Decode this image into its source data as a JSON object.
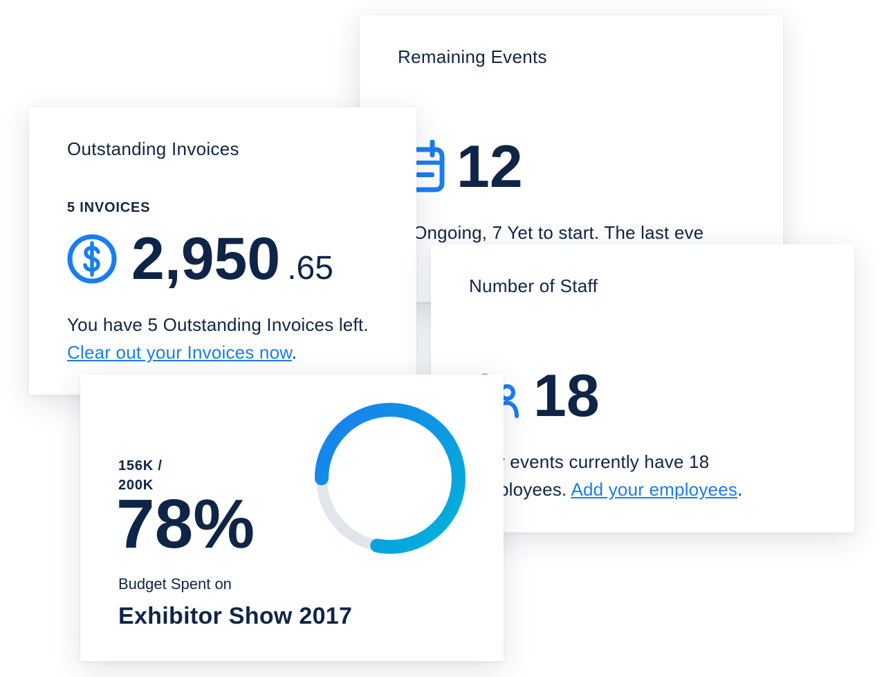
{
  "colors": {
    "accent": "#1a7df0",
    "ring_start": "#00b4d8",
    "ring_end": "#1a7df0",
    "track": "#e2e6ec",
    "text": "#0f2547"
  },
  "events": {
    "title": "Remaining Events",
    "icon": "calendar-icon",
    "count": "12",
    "description": "5 Ongoing, 7 Yet to start. The last eve"
  },
  "invoices": {
    "title": "Outstanding Invoices",
    "kicker": "5 INVOICES",
    "icon": "dollar-icon",
    "amount_whole": "2,950",
    "amount_cents": ".65",
    "description_prefix": "You have 5 Outstanding Invoices left. ",
    "link_text": "Clear out your Invoices now",
    "description_suffix": "."
  },
  "staff": {
    "title": "Number of Staff",
    "icon": "people-icon",
    "count": "18",
    "description_prefix": "r events currently have 18",
    "description_line2": "ployees. ",
    "link_text": "Add your employees",
    "description_suffix": "."
  },
  "budget": {
    "progress_label_line1": "156K /",
    "progress_label_line2": "200K",
    "percent": "78%",
    "progress_fraction": 0.78,
    "caption": "Budget Spent on",
    "event_name": "Exhibitor Show 2017"
  }
}
